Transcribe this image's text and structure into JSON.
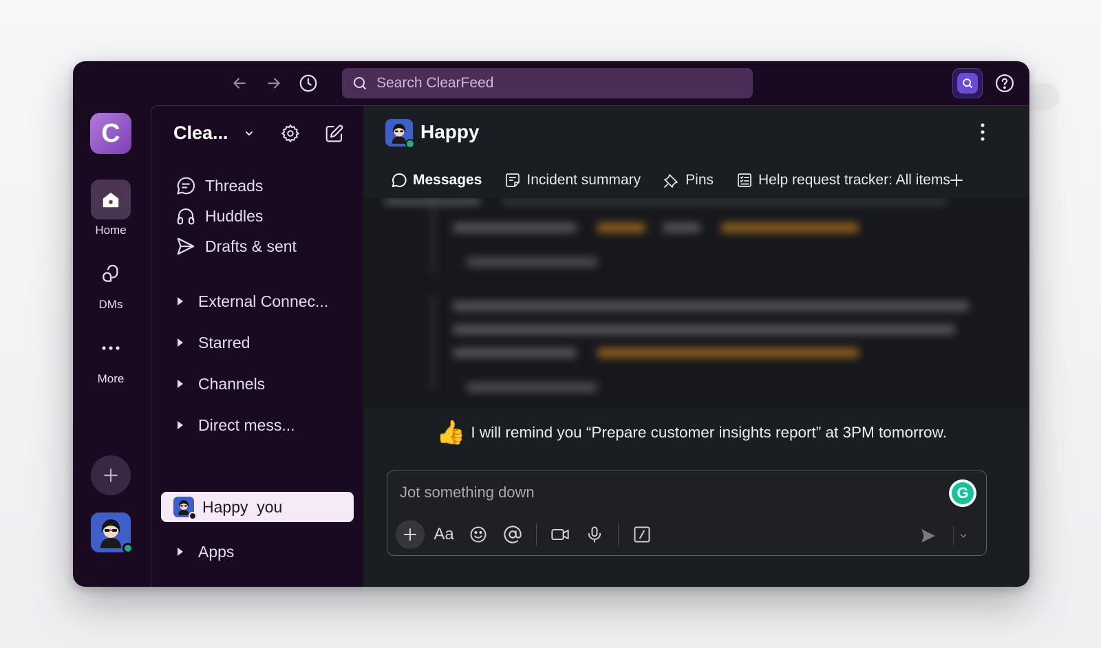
{
  "app": {
    "name": "ClearFeed"
  },
  "topbar": {
    "search_placeholder": "Search ClearFeed",
    "back_icon": "arrow-left-icon",
    "forward_icon": "arrow-right-icon",
    "history_icon": "clock-icon",
    "help_icon": "question-icon"
  },
  "rail": {
    "workspace_letter": "C",
    "items": [
      {
        "label": "Home",
        "icon": "home-icon",
        "active": true
      },
      {
        "label": "DMs",
        "icon": "dms-icon",
        "active": false
      },
      {
        "label": "More",
        "icon": "more-icon",
        "active": false
      }
    ],
    "add_icon": "plus-icon"
  },
  "sidebar": {
    "workspace_name": "Clea...",
    "nav": [
      {
        "label": "Threads",
        "icon": "threads-icon"
      },
      {
        "label": "Huddles",
        "icon": "headphones-icon"
      },
      {
        "label": "Drafts & sent",
        "icon": "send-icon"
      }
    ],
    "sections": [
      {
        "label": "External Connec..."
      },
      {
        "label": "Starred"
      },
      {
        "label": "Channels"
      },
      {
        "label": "Direct mess..."
      },
      {
        "label": "Apps"
      }
    ],
    "active_dm": {
      "label": "Happy  you"
    }
  },
  "main": {
    "channel_name": "Happy",
    "tabs": [
      {
        "label": "Messages",
        "icon": "message-icon",
        "active": true
      },
      {
        "label": "Incident summary",
        "icon": "canvas-icon",
        "active": false
      },
      {
        "label": "Pins",
        "icon": "pin-icon",
        "active": false
      },
      {
        "label": "Help request tracker: All items",
        "icon": "list-icon",
        "active": false
      }
    ],
    "bot_message": {
      "emoji": "👍",
      "text": "I will remind you “Prepare customer insights report” at 3PM tomorrow."
    },
    "composer": {
      "placeholder": "Jot something down",
      "format_label": "Aa",
      "grammarly_letter": "G"
    }
  },
  "colors": {
    "window_bg": "#1a0a21",
    "search_bg": "#4b2e57",
    "active_dm_bg": "#f6e9f8",
    "presence": "#2bac76",
    "accent_purple": "#7d3fb6"
  }
}
